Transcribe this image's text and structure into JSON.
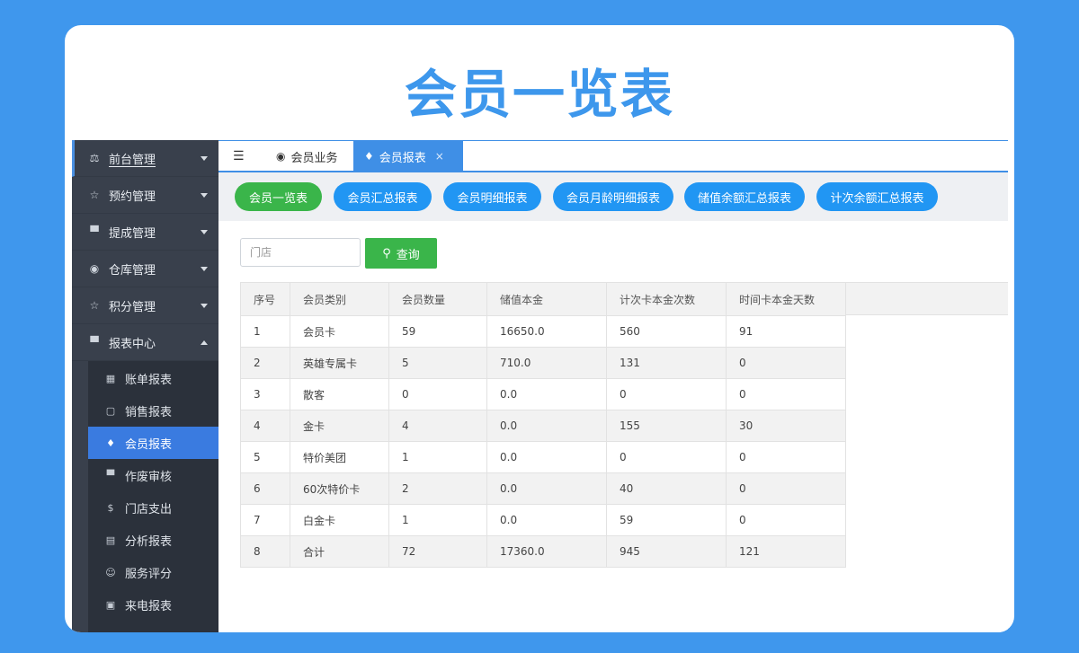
{
  "hero_title": "会员一览表",
  "sidebar": {
    "items": [
      {
        "label": "前台管理",
        "icon": "users-icon",
        "glyph": "⚖",
        "expanded": false
      },
      {
        "label": "预约管理",
        "icon": "star-icon",
        "glyph": "☆",
        "expanded": false
      },
      {
        "label": "提成管理",
        "icon": "monitor-icon",
        "glyph": "▀",
        "expanded": false
      },
      {
        "label": "仓库管理",
        "icon": "dashboard-icon",
        "glyph": "◉",
        "expanded": false
      },
      {
        "label": "积分管理",
        "icon": "star-icon",
        "glyph": "☆",
        "expanded": false
      },
      {
        "label": "报表中心",
        "icon": "monitor-icon",
        "glyph": "▀",
        "expanded": true
      }
    ],
    "subitems": [
      {
        "label": "账单报表",
        "icon": "grid-icon",
        "glyph": "▦"
      },
      {
        "label": "销售报表",
        "icon": "file-icon",
        "glyph": "▢"
      },
      {
        "label": "会员报表",
        "icon": "diamond-icon",
        "glyph": "♦",
        "active": true
      },
      {
        "label": "作废审核",
        "icon": "monitor-icon",
        "glyph": "▀"
      },
      {
        "label": "门店支出",
        "icon": "dollar-icon",
        "glyph": "$"
      },
      {
        "label": "分析报表",
        "icon": "calendar-icon",
        "glyph": "▤"
      },
      {
        "label": "服务评分",
        "icon": "smile-icon",
        "glyph": "☺"
      },
      {
        "label": "来电报表",
        "icon": "phone-icon",
        "glyph": "▣"
      }
    ]
  },
  "tabs": [
    {
      "label": "会员业务",
      "icon": "dashboard-icon",
      "glyph": "◉",
      "active": false
    },
    {
      "label": "会员报表",
      "icon": "diamond-icon",
      "glyph": "♦",
      "active": true,
      "close": "×"
    }
  ],
  "menu_toggle_glyph": "☰",
  "report_buttons": [
    {
      "label": "会员一览表",
      "active": true
    },
    {
      "label": "会员汇总报表",
      "active": false
    },
    {
      "label": "会员明细报表",
      "active": false
    },
    {
      "label": "会员月龄明细报表",
      "active": false
    },
    {
      "label": "储值余额汇总报表",
      "active": false
    },
    {
      "label": "计次余额汇总报表",
      "active": false
    }
  ],
  "search": {
    "placeholder": "门店",
    "value": "",
    "button_label": "查询",
    "button_glyph": "⚲"
  },
  "table": {
    "columns": [
      "序号",
      "会员类别",
      "会员数量",
      "储值本金",
      "计次卡本金次数",
      "时间卡本金天数"
    ],
    "rows": [
      [
        "1",
        "会员卡",
        "59",
        "16650.0",
        "560",
        "91"
      ],
      [
        "2",
        "英雄专属卡",
        "5",
        "710.0",
        "131",
        "0"
      ],
      [
        "3",
        "散客",
        "0",
        "0.0",
        "0",
        "0"
      ],
      [
        "4",
        "金卡",
        "4",
        "0.0",
        "155",
        "30"
      ],
      [
        "5",
        "特价美团",
        "1",
        "0.0",
        "0",
        "0"
      ],
      [
        "6",
        "60次特价卡",
        "2",
        "0.0",
        "40",
        "0"
      ],
      [
        "7",
        "白金卡",
        "1",
        "0.0",
        "59",
        "0"
      ],
      [
        "8",
        "合计",
        "72",
        "17360.0",
        "945",
        "121"
      ]
    ]
  },
  "colors": {
    "background": "#3f97ed",
    "title": "#3d97ec",
    "sidebar": "#39404c",
    "submenu": "#2b313b",
    "accent": "#3a7be0",
    "pill_blue": "#2196f3",
    "pill_green": "#3ab54a"
  }
}
